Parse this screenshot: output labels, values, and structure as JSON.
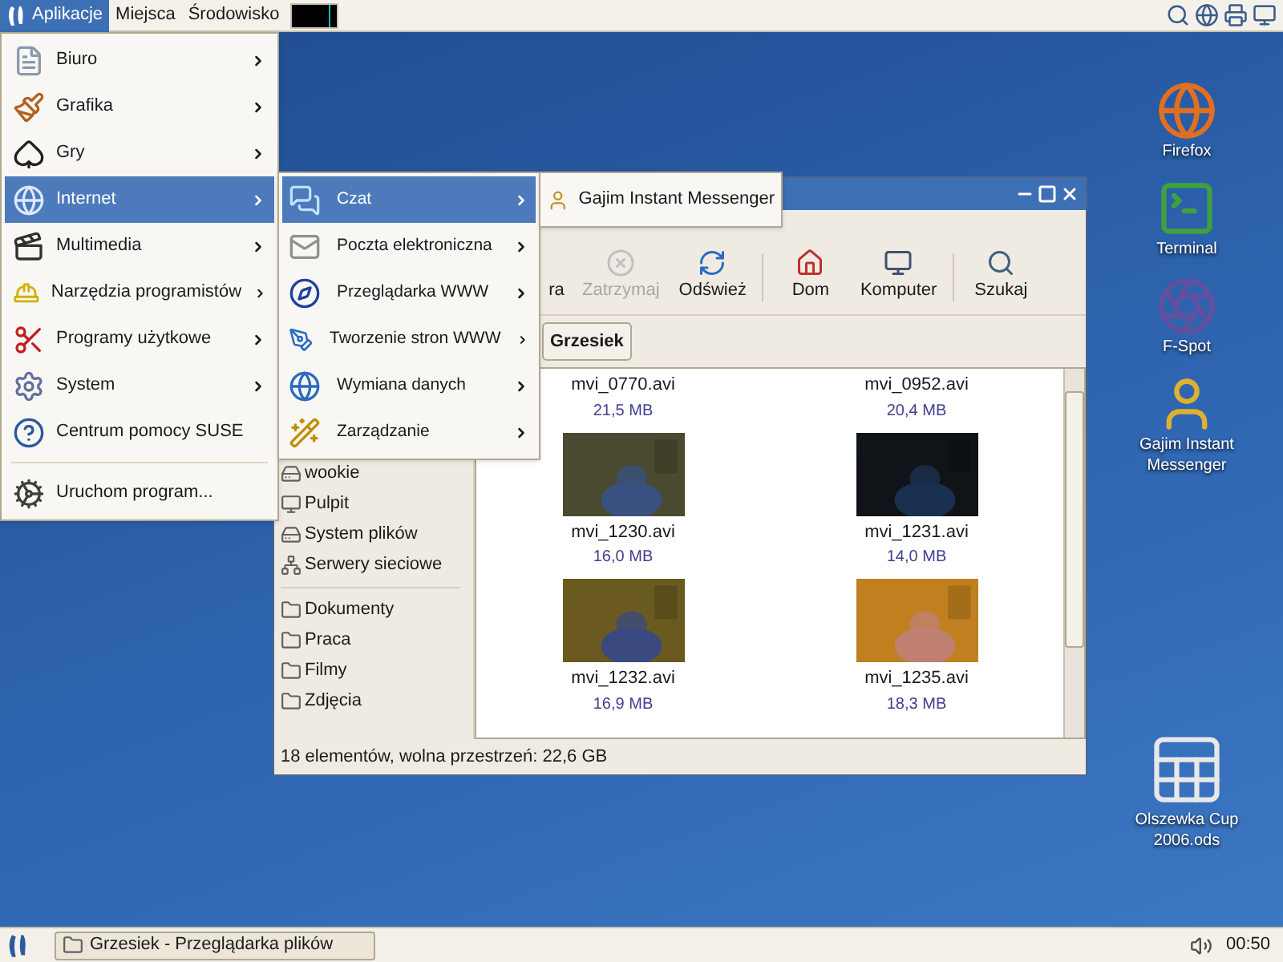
{
  "top_panel": {
    "menus": [
      {
        "label": "Aplikacje",
        "selected": true
      },
      {
        "label": "Miejsca",
        "selected": false
      },
      {
        "label": "Środowisko",
        "selected": false
      }
    ]
  },
  "app_menu": {
    "items": [
      {
        "kind": "item",
        "label": "Biuro",
        "submenu": true,
        "selected": false
      },
      {
        "kind": "item",
        "label": "Grafika",
        "submenu": true,
        "selected": false
      },
      {
        "kind": "item",
        "label": "Gry",
        "submenu": true,
        "selected": false
      },
      {
        "kind": "item",
        "label": "Internet",
        "submenu": true,
        "selected": true
      },
      {
        "kind": "item",
        "label": "Multimedia",
        "submenu": true,
        "selected": false
      },
      {
        "kind": "item",
        "label": "Narzędzia programistów",
        "submenu": true,
        "selected": false
      },
      {
        "kind": "item",
        "label": "Programy użytkowe",
        "submenu": true,
        "selected": false
      },
      {
        "kind": "item",
        "label": "System",
        "submenu": true,
        "selected": false
      },
      {
        "kind": "item",
        "label": "Centrum pomocy SUSE",
        "submenu": false,
        "selected": false
      },
      {
        "kind": "separator"
      },
      {
        "kind": "item",
        "label": "Uruchom program...",
        "submenu": false,
        "selected": false
      }
    ]
  },
  "internet_menu": {
    "items": [
      {
        "label": "Czat",
        "submenu": true,
        "selected": true
      },
      {
        "label": "Poczta elektroniczna",
        "submenu": true,
        "selected": false
      },
      {
        "label": "Przeglądarka WWW",
        "submenu": true,
        "selected": false
      },
      {
        "label": "Tworzenie stron WWW",
        "submenu": true,
        "selected": false
      },
      {
        "label": "Wymiana danych",
        "submenu": true,
        "selected": false
      },
      {
        "label": "Zarządzanie",
        "submenu": true,
        "selected": false
      }
    ]
  },
  "chat_menu": {
    "items": [
      {
        "label": "Gajim Instant Messenger",
        "selected": false
      }
    ]
  },
  "file_manager": {
    "toolbar": [
      {
        "label": "ra",
        "disabled": false
      },
      {
        "label": "Zatrzymaj",
        "disabled": true
      },
      {
        "label": "Odśwież",
        "disabled": false
      },
      {
        "label": "Dom",
        "disabled": false
      },
      {
        "label": "Komputer",
        "disabled": false
      },
      {
        "label": "Szukaj",
        "disabled": false
      }
    ],
    "location_button": "Grzesiek",
    "sidebar": [
      {
        "kind": "device",
        "label": "wookie"
      },
      {
        "kind": "device",
        "label": "Pulpit"
      },
      {
        "kind": "device",
        "label": "System plików"
      },
      {
        "kind": "device",
        "label": "Serwery sieciowe"
      },
      {
        "kind": "separator"
      },
      {
        "kind": "folder",
        "label": "Dokumenty"
      },
      {
        "kind": "folder",
        "label": "Praca"
      },
      {
        "kind": "folder",
        "label": "Filmy"
      },
      {
        "kind": "folder",
        "label": "Zdjęcia"
      }
    ],
    "files": [
      {
        "name": "mvi_0770.avi",
        "size": "21,5 MB"
      },
      {
        "name": "mvi_0952.avi",
        "size": "20,4 MB"
      },
      {
        "name": "mvi_1230.avi",
        "size": "16,0 MB",
        "kind": "picture"
      },
      {
        "name": "mvi_1231.avi",
        "size": "14,0 MB",
        "kind": "picture"
      },
      {
        "name": "mvi_1232.avi",
        "size": "16,9 MB",
        "kind": "picture"
      },
      {
        "name": "mvi_1235.avi",
        "size": "18,3 MB",
        "kind": "picture"
      }
    ],
    "status": "18 elementów, wolna przestrzeń: 22,6 GB"
  },
  "desktop_icons": [
    {
      "label": "Firefox"
    },
    {
      "label": "Terminal"
    },
    {
      "label": "F-Spot"
    },
    {
      "label": "Gajim Instant Messenger"
    }
  ],
  "desktop_file": {
    "label": "Olszewka Cup 2006.ods"
  },
  "bottom_panel": {
    "task": "Grzesiek - Przeglądarka plików",
    "clock": "00:50"
  }
}
